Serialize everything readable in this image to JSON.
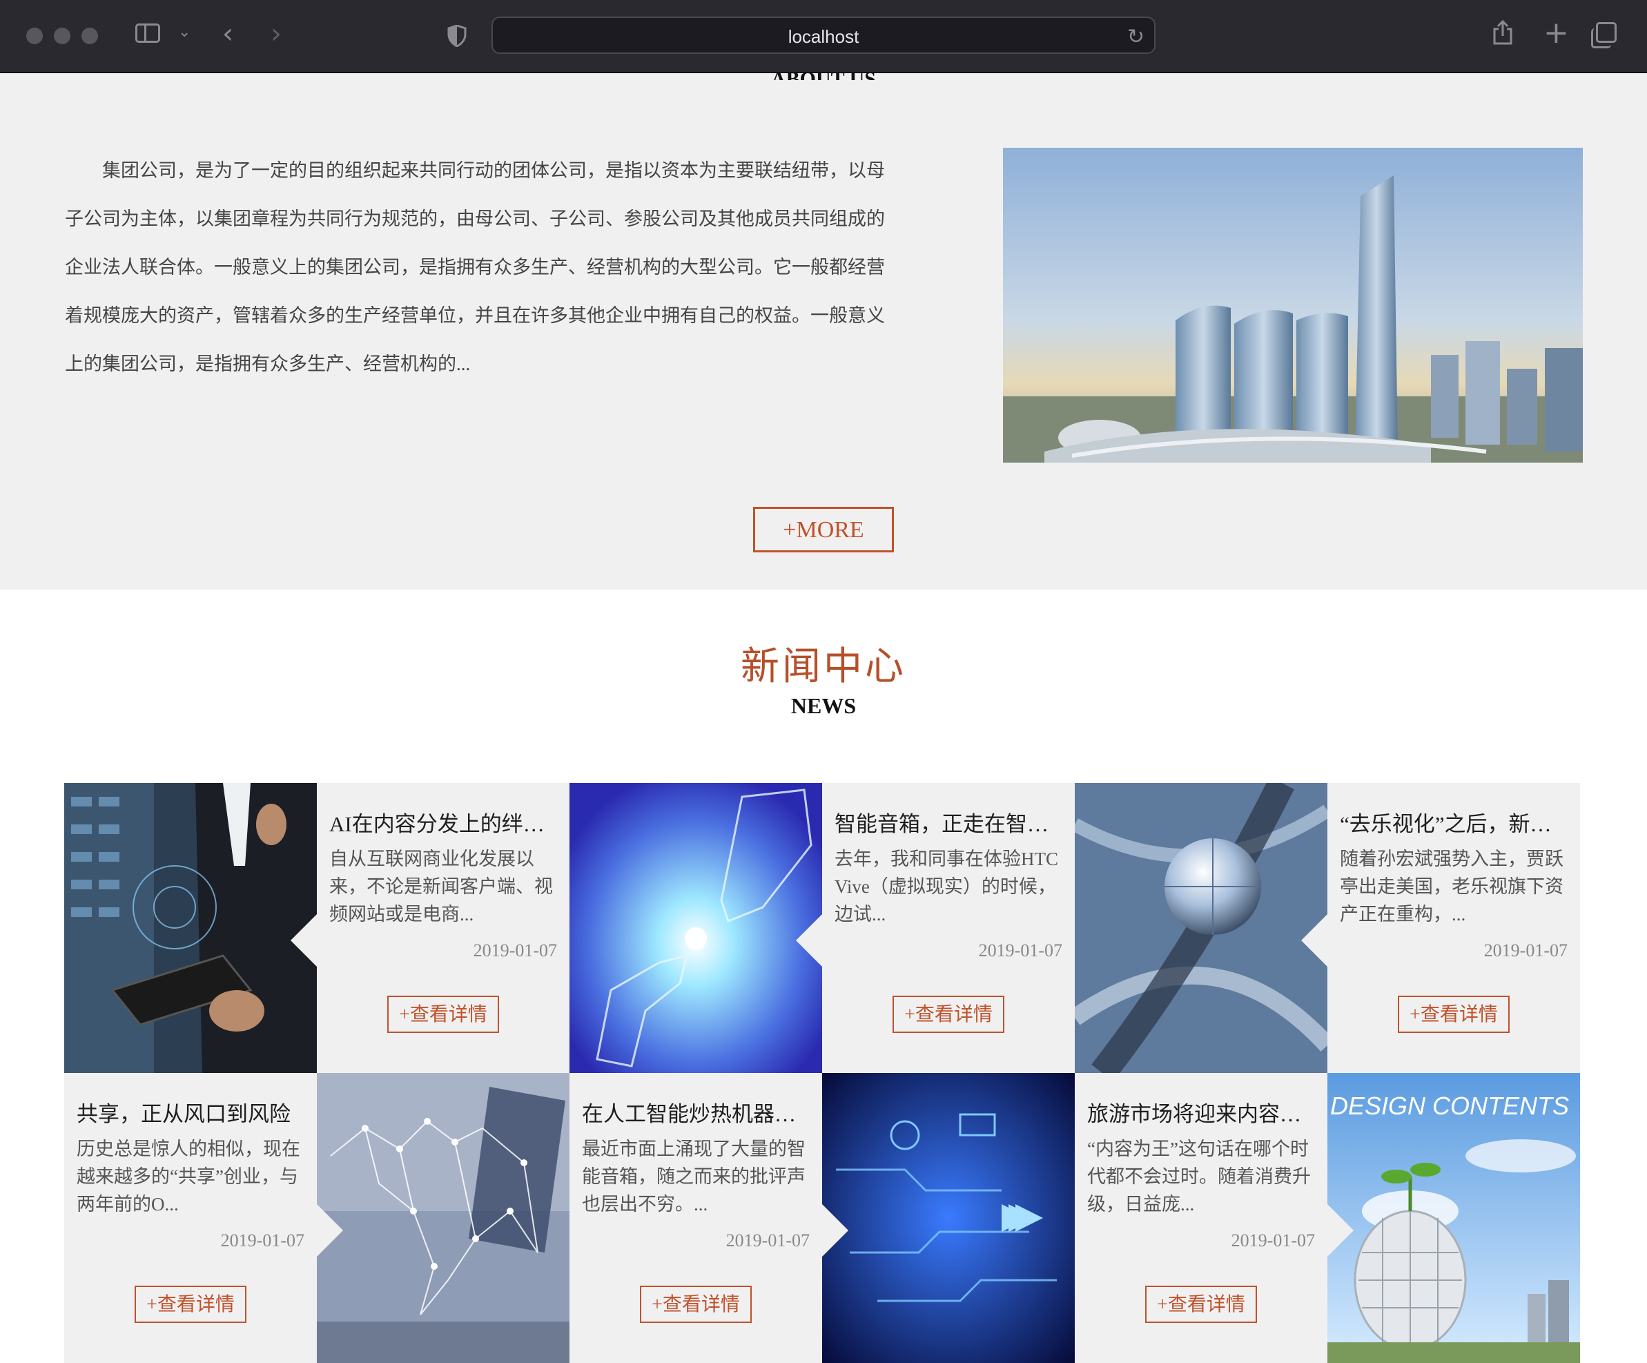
{
  "browser": {
    "url": "localhost"
  },
  "about": {
    "title": "ABOUT US",
    "text": "集团公司，是为了一定的目的组织起来共同行动的团体公司，是指以资本为主要联结纽带，以母子公司为主体，以集团章程为共同行为规范的，由母公司、子公司、参股公司及其他成员共同组成的企业法人联合体。一般意义上的集团公司，是指拥有众多生产、经营机构的大型公司。它一般都经营着规模庞大的资产，管辖着众多的生产经营单位，并且在许多其他企业中拥有自己的权益。一般意义上的集团公司，是指拥有众多生产、经营机构的...",
    "more_label": "+MORE"
  },
  "news": {
    "title_cn": "新闻中心",
    "title_en": "NEWS",
    "items": [
      {
        "title": "AI在内容分发上的绊脚石",
        "summary": "自从互联网商业化发展以来，不论是新闻客户端、视频网站或是电商...",
        "date": "2019-01-07",
        "button": "+查看详情"
      },
      {
        "title": "智能音箱，正走在智能化的路上",
        "summary": "去年，我和同事在体验HTC Vive（虚拟现实）的时候，边试...",
        "date": "2019-01-07",
        "button": "+查看详情"
      },
      {
        "title": "“去乐视化”之后，新乐视何去何从",
        "summary": "随着孙宏斌强势入主，贾跃亭出走美国，老乐视旗下资产正在重构，...",
        "date": "2019-01-07",
        "button": "+查看详情"
      },
      {
        "title": "共享，正从风口到风险",
        "summary": "历史总是惊人的相似，现在越来越多的“共享”创业，与两年前的O...",
        "date": "2019-01-07",
        "button": "+查看详情"
      },
      {
        "title": "在人工智能炒热机器人之后",
        "summary": "最近市面上涌现了大量的智能音箱，随之而来的批评声也层出不穷。...",
        "date": "2019-01-07",
        "button": "+查看详情"
      },
      {
        "title": "旅游市场将迎来内容营销时代",
        "summary": "“内容为王”这句话在哪个时代都不会过时。随着消费升级，日益庞...",
        "date": "2019-01-07",
        "button": "+查看详情"
      }
    ],
    "image_texts": {
      "design_contents": "DESIGN CONTENTS"
    }
  },
  "colors": {
    "accent": "#c0522a",
    "section_bg": "#f1f0f1",
    "chrome_bg": "#2a2930"
  }
}
